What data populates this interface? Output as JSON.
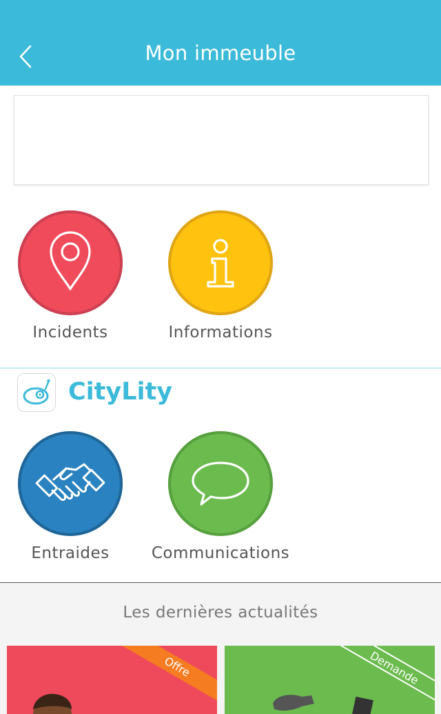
{
  "header": {
    "title": "Mon immeuble",
    "back_icon": "chevron-left-icon",
    "background": "#3bbad9"
  },
  "building_tiles": [
    {
      "label": "Incidents",
      "icon": "map-pin-icon",
      "color": "#f04b5a",
      "border": "#cc4052"
    },
    {
      "label": "Informations",
      "icon": "info-icon",
      "color": "#ffc20e",
      "border": "#e0a516"
    }
  ],
  "brand": {
    "name": "CityLity",
    "color": "#3bbad9"
  },
  "community_tiles": [
    {
      "label": "Entraides",
      "icon": "handshake-icon",
      "color": "#2a82c0",
      "border": "#1f6598"
    },
    {
      "label": "Communications",
      "icon": "speech-bubble-icon",
      "color": "#6bbb4e",
      "border": "#56a03e"
    }
  ],
  "news": {
    "heading": "Les dernières actualités",
    "cards": [
      {
        "ribbon": "Offre",
        "ribbon_color": "#f57c20",
        "background": "#ef4a5b"
      },
      {
        "ribbon": "Demande",
        "ribbon_color": "#6bbb4e",
        "background": "#6bbb4e"
      }
    ]
  }
}
